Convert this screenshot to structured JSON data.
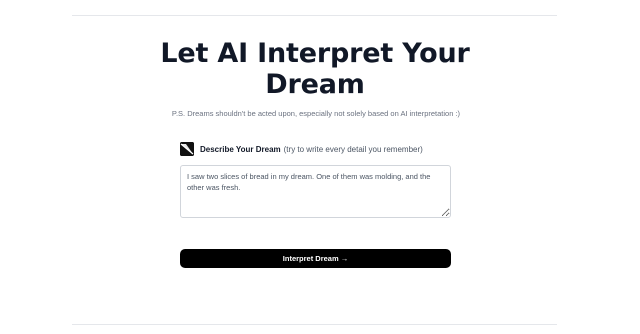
{
  "header": {
    "title_line1": "Let AI Interpret Your",
    "title_line2": "Dream",
    "subtitle": "P.S. Dreams shouldn't be acted upon, especially not solely based on AI interpretation :)"
  },
  "form": {
    "step_icon": "step-badge-icon",
    "label": "Describe Your Dream",
    "hint": "(try to write every detail you remember)",
    "dream_value": "I saw two slices of bread in my dream. One of them was molding, and the other was fresh.",
    "submit_label": "Interpret Dream →"
  },
  "colors": {
    "button_bg": "#000000",
    "title": "#111827",
    "subtitle": "#6b7280"
  }
}
